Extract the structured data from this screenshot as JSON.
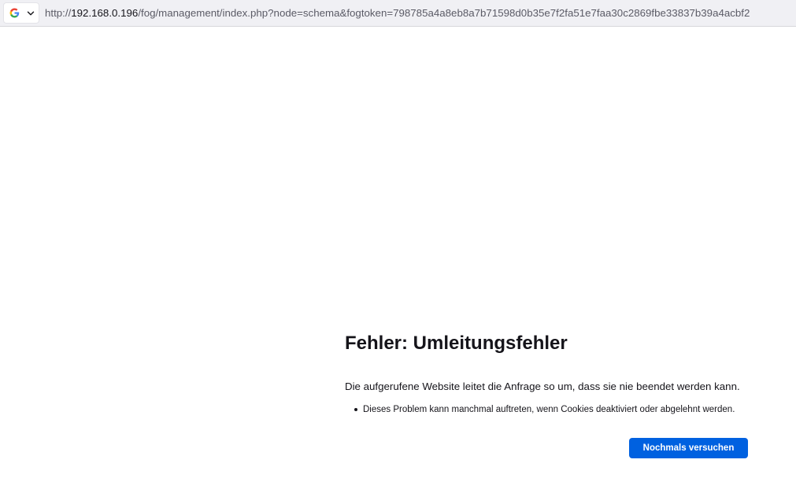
{
  "urlbar": {
    "identity_icon": "google-icon",
    "dropdown_icon": "chevron-down-icon",
    "url_scheme": "http://",
    "url_host": "192.168.0.196",
    "url_path": "/fog/management/index.php?node=schema&fogtoken=798785a4a8eb8a7b71598d0b35e7f2fa51e7faa30c2869fbe33837b39a4acbf2"
  },
  "error_page": {
    "title": "Fehler: Umleitungsfehler",
    "description": "Die aufgerufene Website leitet die Anfrage so um, dass sie nie beendet werden kann.",
    "hints": [
      "Dieses Problem kann manchmal auftreten, wenn Cookies deaktiviert oder abgelehnt werden."
    ],
    "retry_label": "Nochmals versuchen"
  },
  "colors": {
    "button": "#0061e0",
    "urlbar_bg": "#f0f0f4",
    "text": "#15141a"
  }
}
